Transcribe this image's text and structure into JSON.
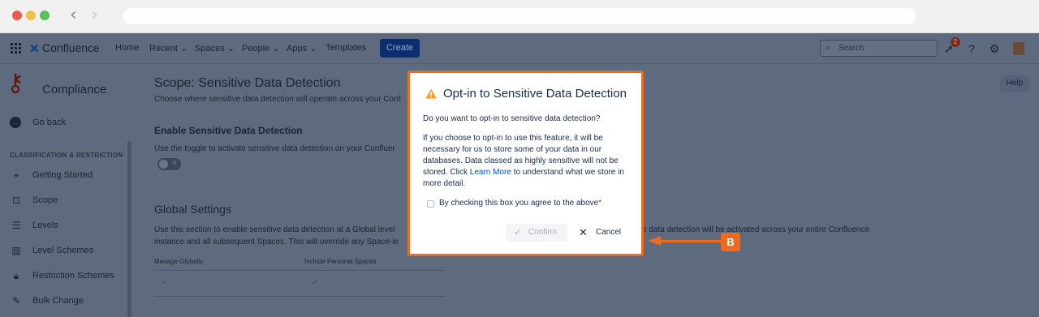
{
  "topnav": {
    "logo_text": "Confluence",
    "items": [
      "Home",
      "Recent",
      "Spaces",
      "People",
      "Apps",
      "Templates"
    ],
    "create_label": "Create",
    "search_placeholder": "Search",
    "notification_count": "2"
  },
  "sidebar": {
    "title": "Compliance",
    "go_back": "Go back",
    "section": "CLASSIFICATION & RESTRICTION",
    "items": [
      {
        "label": "Getting Started",
        "icon": "pin-icon"
      },
      {
        "label": "Scope",
        "icon": "scope-icon"
      },
      {
        "label": "Levels",
        "icon": "levels-icon"
      },
      {
        "label": "Level Schemes",
        "icon": "level-schemes-icon"
      },
      {
        "label": "Restriction Schemes",
        "icon": "lock-icon"
      },
      {
        "label": "Bulk Change",
        "icon": "pencil-icon"
      }
    ]
  },
  "main": {
    "title": "Scope: Sensitive Data Detection",
    "subtitle": "Choose where sensitive data detection will operate across your Conf",
    "enable_heading": "Enable Sensitive Data Detection",
    "toggle_desc": "Use the toggle to activate sensitive data detection on your Confluer",
    "global_heading": "Global Settings",
    "global_desc_left1": "Use this section to enable sensitive data detection at a Global level",
    "global_desc_right1": "e data detection will be activated across your entire Confluence",
    "global_desc_left2": "instance and all subsequent Spaces. This will override any Space-le",
    "col_manage": "Manage Globally",
    "col_personal": "Include Personal Spaces",
    "help": "Help"
  },
  "modal": {
    "title": "Opt-in to Sensitive Data Detection",
    "question": "Do you want to opt-in to sensitive data detection?",
    "body_before_link": "If you choose to opt-in to use this feature, it will be necessary for us to store some of your data in our databases. Data classed as highly sensitive will not be stored. Click ",
    "link_text": "Learn More",
    "body_after_link": " to understand what we store in more detail.",
    "checkbox_label": "By checking this box you agree to the above",
    "required_mark": "*",
    "confirm_label": "Confirm",
    "cancel_label": "Cancel"
  },
  "callout": {
    "label": "B",
    "color": "#f06a1e"
  }
}
